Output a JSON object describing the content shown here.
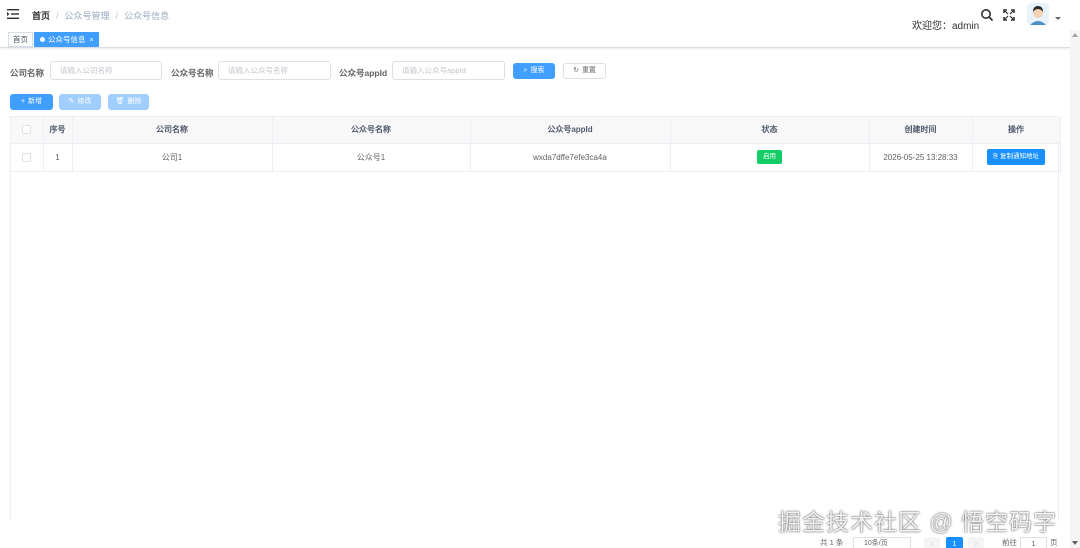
{
  "header": {
    "breadcrumb": [
      "首页",
      "公众号管理",
      "公众号信息"
    ],
    "welcome": "欢迎您：admin",
    "icons": [
      "hamburger-icon",
      "search-icon",
      "fullscreen-icon",
      "avatar",
      "caret-down-icon"
    ]
  },
  "tags": {
    "home": "首页",
    "active": "公众号信息",
    "close": "×"
  },
  "search": {
    "company_label": "公司名称",
    "company_placeholder": "请输入公司名称",
    "account_label": "公众号名称",
    "account_placeholder": "请输入公众号名称",
    "appid_label": "公众号appId",
    "appid_placeholder": "请输入公众号appId",
    "search_button": "搜索",
    "reset_button": "重置"
  },
  "toolbar": {
    "add_button": "新增",
    "edit_button": "修改",
    "delete_button": "删除"
  },
  "table": {
    "columns": [
      "",
      "序号",
      "公司名称",
      "公众号名称",
      "公众号appId",
      "状态",
      "创建时间",
      "操作"
    ],
    "rows": [
      {
        "index": "1",
        "company": "公司1",
        "account": "公众号1",
        "appid": "wxda7dffe7efe3ca4a",
        "status": "启用",
        "created": "2026-05-25 13:28:33",
        "action": "复制通知地址"
      }
    ]
  },
  "pagination": {
    "total": "共 1 条",
    "page_size": "10条/页",
    "current_page": "1",
    "jump_label": "前往",
    "jump_value": "1",
    "page_unit": "页"
  },
  "watermark": "掘金技术社区 @ 悟空码字",
  "colors": {
    "primary": "#409eff",
    "primary_light": "#a0cfff",
    "success": "#13ce66",
    "op_blue": "#1890ff"
  }
}
